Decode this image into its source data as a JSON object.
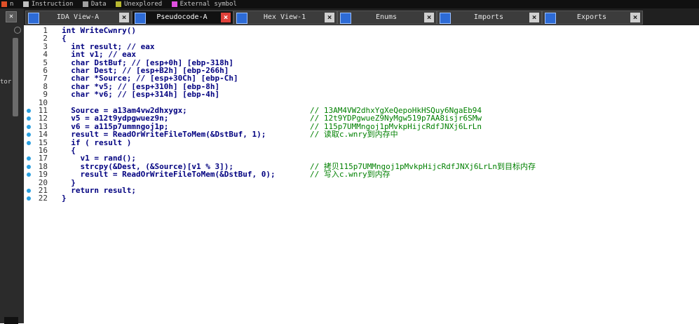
{
  "legend": [
    {
      "label": "n",
      "color": "#e05028"
    },
    {
      "label": "Instruction",
      "color": "#c0c0c0"
    },
    {
      "label": "Data",
      "color": "#a0a0a0"
    },
    {
      "label": "Unexplored",
      "color": "#b8b830"
    },
    {
      "label": "External symbol",
      "color": "#e050e0"
    }
  ],
  "left_pane": {
    "stub": "tor"
  },
  "tabs": [
    {
      "label": "IDA View-A",
      "active": false
    },
    {
      "label": "Pseudocode-A",
      "active": true
    },
    {
      "label": "Hex View-1",
      "active": false
    },
    {
      "label": "Enums",
      "active": false
    },
    {
      "label": "Imports",
      "active": false
    },
    {
      "label": "Exports",
      "active": false
    }
  ],
  "code": [
    {
      "n": "1",
      "bp": false,
      "src": "int WriteCwnry()",
      "comment": ""
    },
    {
      "n": "2",
      "bp": false,
      "src": "{",
      "comment": ""
    },
    {
      "n": "3",
      "bp": false,
      "src": "  int result; // eax",
      "comment": ""
    },
    {
      "n": "4",
      "bp": false,
      "src": "  int v1; // eax",
      "comment": ""
    },
    {
      "n": "5",
      "bp": false,
      "src": "  char DstBuf; // [esp+0h] [ebp-318h]",
      "comment": ""
    },
    {
      "n": "6",
      "bp": false,
      "src": "  char Dest; // [esp+B2h] [ebp-266h]",
      "comment": ""
    },
    {
      "n": "7",
      "bp": false,
      "src": "  char *Source; // [esp+30Ch] [ebp-Ch]",
      "comment": ""
    },
    {
      "n": "8",
      "bp": false,
      "src": "  char *v5; // [esp+310h] [ebp-8h]",
      "comment": ""
    },
    {
      "n": "9",
      "bp": false,
      "src": "  char *v6; // [esp+314h] [ebp-4h]",
      "comment": ""
    },
    {
      "n": "10",
      "bp": false,
      "src": "",
      "comment": ""
    },
    {
      "n": "11",
      "bp": true,
      "src": "  Source = a13am4vw2dhxygx;",
      "comment": "// 13AM4VW2dhxYgXeQepoHkHSQuy6NgaEb94"
    },
    {
      "n": "12",
      "bp": true,
      "src": "  v5 = a12t9ydpgwuez9n;",
      "comment": "// 12t9YDPgwueZ9NyMgw519p7AA8isjr6SMw"
    },
    {
      "n": "13",
      "bp": true,
      "src": "  v6 = a115p7ummngoj1p;",
      "comment": "// 115p7UMMngoj1pMvkpHijcRdfJNXj6LrLn"
    },
    {
      "n": "14",
      "bp": true,
      "src": "  result = ReadOrWriteFileToMem(&DstBuf, 1);",
      "comment": "// 读取c.wnry到内存中"
    },
    {
      "n": "15",
      "bp": true,
      "src": "  if ( result )",
      "comment": ""
    },
    {
      "n": "16",
      "bp": false,
      "src": "  {",
      "comment": ""
    },
    {
      "n": "17",
      "bp": true,
      "src": "    v1 = rand();",
      "comment": ""
    },
    {
      "n": "18",
      "bp": true,
      "src": "    strcpy(&Dest, (&Source)[v1 % 3]);",
      "comment": "// 拷贝115p7UMMngoj1pMvkpHijcRdfJNXj6LrLn到目标内存"
    },
    {
      "n": "19",
      "bp": true,
      "src": "    result = ReadOrWriteFileToMem(&DstBuf, 0);",
      "comment": "// 写入c.wnry到内存"
    },
    {
      "n": "20",
      "bp": false,
      "src": "  }",
      "comment": ""
    },
    {
      "n": "21",
      "bp": true,
      "src": "  return result;",
      "comment": ""
    },
    {
      "n": "22",
      "bp": true,
      "src": "}",
      "comment": ""
    }
  ]
}
